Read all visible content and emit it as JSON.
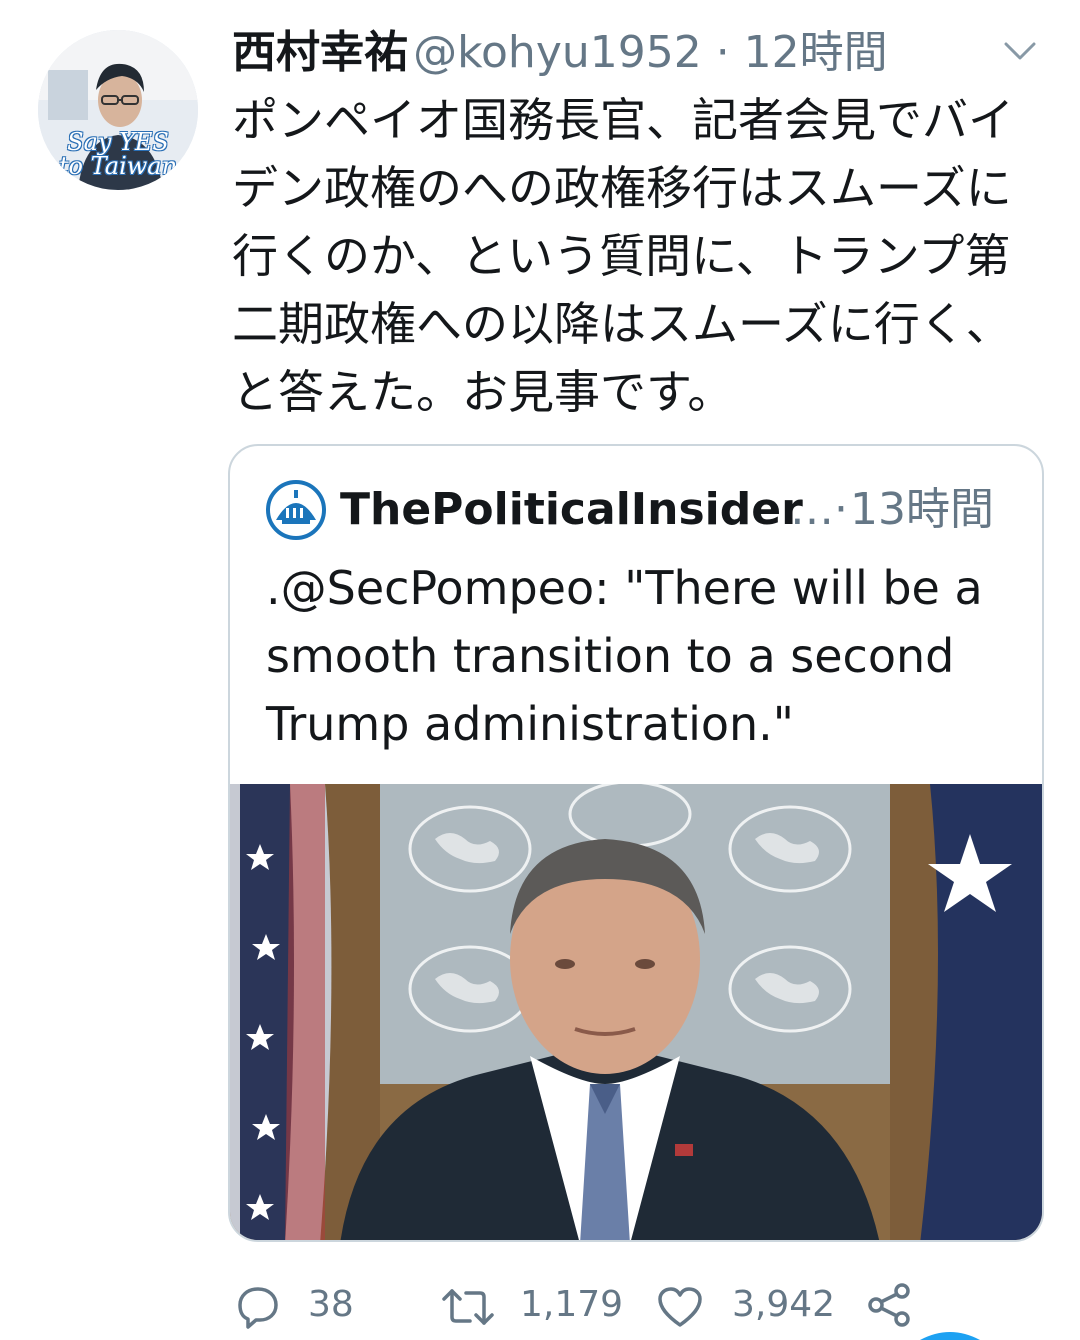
{
  "tweet": {
    "avatar_text_line1": "Say YES",
    "avatar_text_line2": "to Taiwan",
    "display_name": "西村幸祐",
    "handle_time": "@kohyu1952 · 12時間",
    "text": "ポンペイオ国務長官、記者会見でバイデン政権のへの政権移行はスムーズに行くのか、という質問に、トランプ第二期政権への以降はスムーズに行く、と答えた。お見事です。",
    "menu_icon": "chevron-down-icon"
  },
  "quote": {
    "display_name": "ThePoliticalInsider",
    "ellipsis": "…·",
    "time": "13時間",
    "text": ".@SecPompeo: \"There will be a smooth transition to a second Trump administration.\"",
    "media_alt": "video-thumbnail"
  },
  "actions": {
    "reply_count": "38",
    "retweet_count": "1,179",
    "like_count": "3,942",
    "icons": [
      "reply-icon",
      "retweet-icon",
      "like-icon",
      "share-icon"
    ]
  },
  "colors": {
    "text_primary": "#14171a",
    "text_secondary": "#657786",
    "border": "#ccd6dd",
    "brand_blue": "#1b75bb"
  }
}
